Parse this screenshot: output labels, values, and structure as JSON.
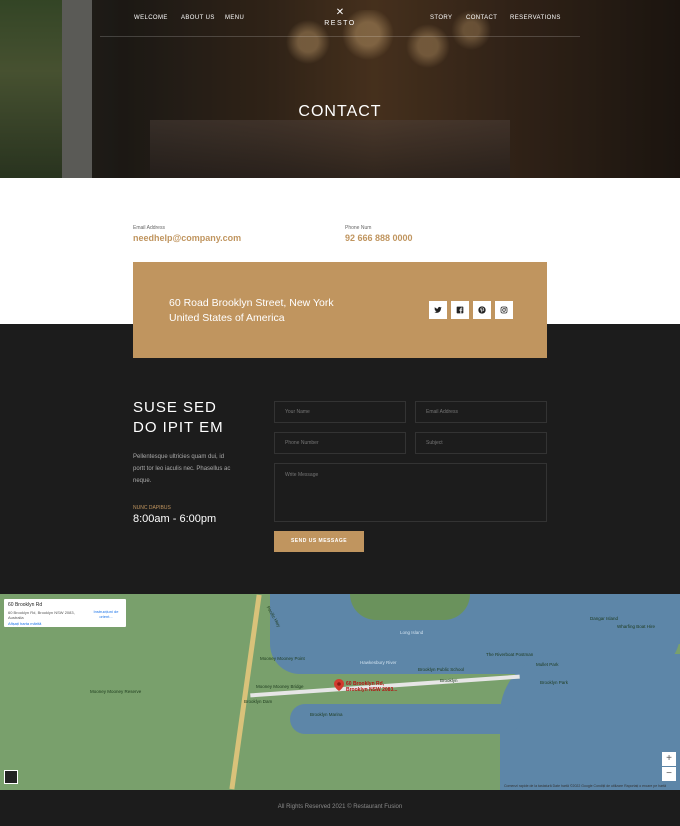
{
  "nav": {
    "welcome": "WELCOME",
    "about": "ABOUT US",
    "menu": "MENU",
    "logo": "RESTO",
    "logo_icon": "fork-knife-icon",
    "story": "STORY",
    "contact": "CONTACT",
    "reservations": "RESERVATIONS"
  },
  "hero": {
    "title": "CONTACT"
  },
  "contact_info": {
    "email_label": "Email Address",
    "email": "needhelp@company.com",
    "phone_label": "Phone Num",
    "phone": "92 666 888 0000"
  },
  "address_card": {
    "address": "60 Road Brooklyn Street, New York United States of America",
    "social_icons": [
      "twitter-icon",
      "facebook-icon",
      "pinterest-icon",
      "instagram-icon"
    ]
  },
  "section": {
    "title_line1": "SUSE SED",
    "title_line2": "DO IPIT EM",
    "text": "Pellentesque ultricies quam dui, id portt tor leo iaculis nec. Phasellus ac neque.",
    "hours_label": "NUNC DAPIBUS",
    "hours": "8:00am - 6:00pm"
  },
  "form": {
    "name_placeholder": "Your Name",
    "email_placeholder": "Email Address",
    "phone_placeholder": "Phone Number",
    "subject_placeholder": "Subject",
    "message_placeholder": "Write Message",
    "send_label": "SEND US MESSAGE"
  },
  "map": {
    "card_title": "60 Brooklyn Rd",
    "card_address": "60 Brooklyn Rd, Brooklyn NSW 2083, Australia",
    "card_link": "Afișați harta mărită",
    "card_directions": "Instrucțiuni de orient...",
    "pin_label_line1": "60 Brooklyn Rd,",
    "pin_label_line2": "Brooklyn NSW 2083...",
    "labels": {
      "long_island": "Long Island",
      "hawkesbury_river": "Hawkesbury River",
      "brooklyn_school": "Brooklyn Public School",
      "riverboat_postman": "The Riverboat Postman",
      "mooney_point": "Mooney Mooney Point",
      "mooney_bridge": "Mooney Mooney Bridge",
      "brooklyn_dam": "Brooklyn Dam",
      "mooney_reserve": "Mooney Mooney Reserve",
      "pacific_hwy": "Pacific Hwy",
      "dangar_island": "Dangar Island",
      "mullet_park": "Mullet Park",
      "brooklyn": "Brooklyn",
      "brooklyn_park": "Brooklyn Park",
      "brooklyn_marina": "Brooklyn Marina",
      "wharfing_boat_hire": "Wharfing Boat Hire"
    },
    "zoom_in": "+",
    "zoom_out": "−",
    "attribution": "Comenzi rapide de la tastatură   Date hartă ©2022 Google   Condiții de utilizare   Raportați o eroare pe hartă"
  },
  "footer": {
    "text": "All Rights Reserved 2021 © Restaurant Fusion"
  },
  "colors": {
    "accent": "#c0955f",
    "dark": "#1c1c1c"
  }
}
